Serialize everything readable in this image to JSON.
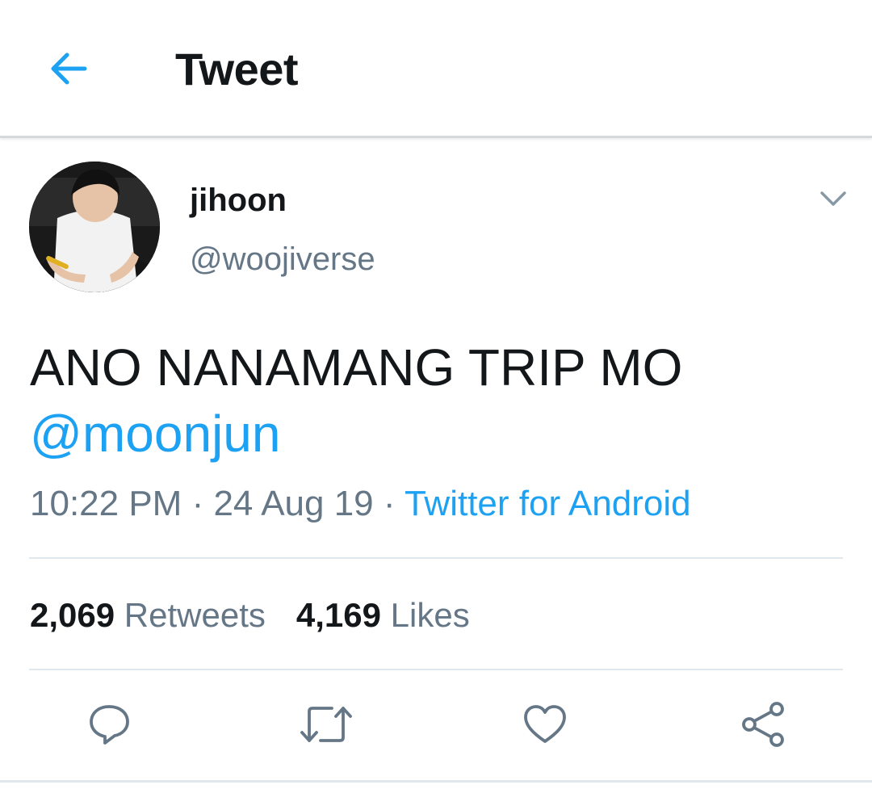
{
  "header": {
    "title": "Tweet",
    "back_icon": "arrow-left-icon"
  },
  "author": {
    "display_name": "jihoon",
    "handle": "@woojiverse"
  },
  "tweet": {
    "text": "ANO NANAMANG TRIP MO",
    "mention": "@moonjun",
    "time": "10:22 PM",
    "separator": " · ",
    "date": "24 Aug 19",
    "source": "Twitter for Android"
  },
  "stats": {
    "retweets_count": "2,069",
    "retweets_label": "Retweets",
    "likes_count": "4,169",
    "likes_label": "Likes"
  },
  "actions": {
    "icons": [
      "reply-icon",
      "retweet-icon",
      "like-icon",
      "share-icon"
    ]
  },
  "colors": {
    "accent": "#1da1f2",
    "text_primary": "#14171a",
    "text_secondary": "#657786",
    "divider": "#e1e8ed",
    "icon_gray": "#657786"
  }
}
